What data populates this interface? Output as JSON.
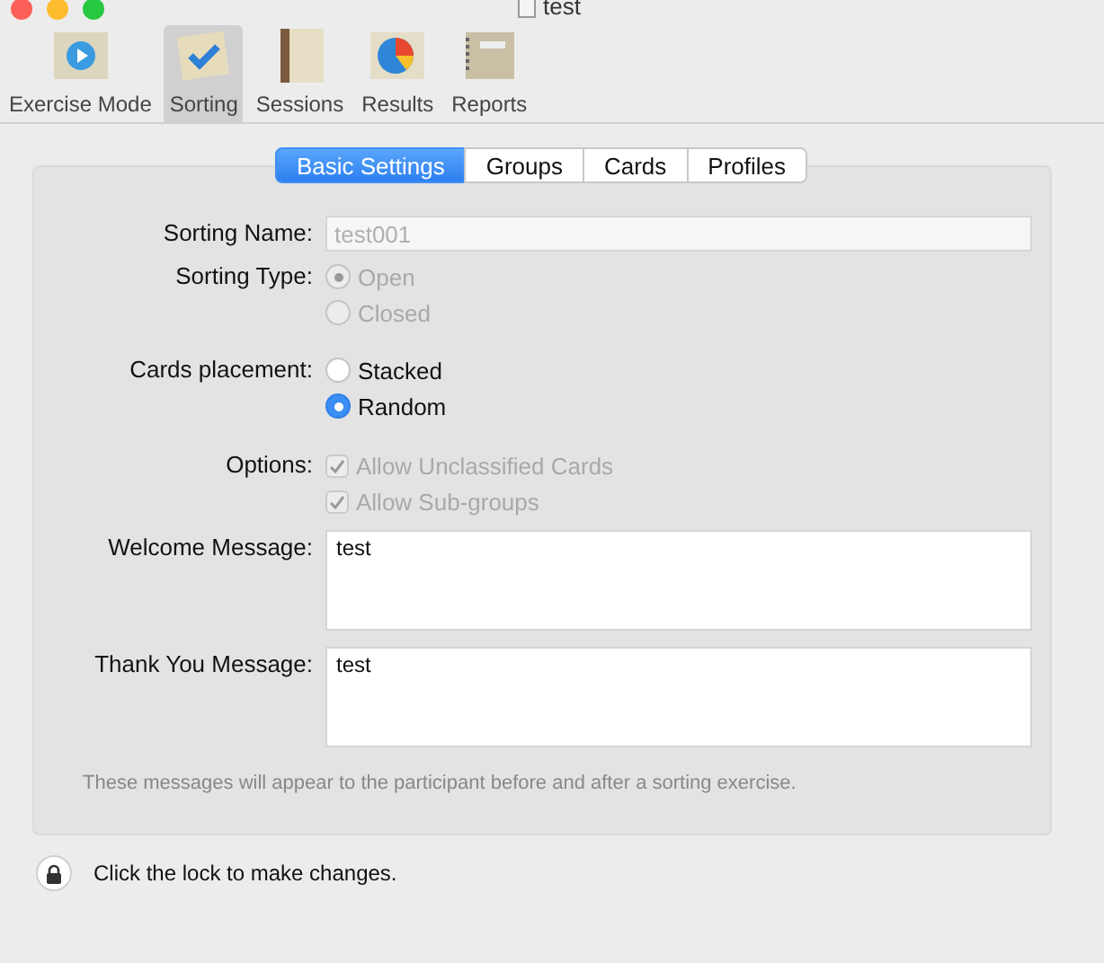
{
  "window": {
    "title": "test"
  },
  "toolbar": [
    {
      "label": "Exercise Mode",
      "selected": false,
      "kind": "play"
    },
    {
      "label": "Sorting",
      "selected": true,
      "kind": "check"
    },
    {
      "label": "Sessions",
      "selected": false,
      "kind": "book"
    },
    {
      "label": "Results",
      "selected": false,
      "kind": "pie"
    },
    {
      "label": "Reports",
      "selected": false,
      "kind": "notebook"
    }
  ],
  "tabs": [
    {
      "label": "Basic Settings",
      "selected": true
    },
    {
      "label": "Groups",
      "selected": false
    },
    {
      "label": "Cards",
      "selected": false
    },
    {
      "label": "Profiles",
      "selected": false
    }
  ],
  "form": {
    "sorting_name": {
      "label": "Sorting Name:",
      "value": "test001",
      "disabled": true
    },
    "sorting_type": {
      "label": "Sorting Type:",
      "disabled": true,
      "options": [
        {
          "label": "Open",
          "selected": true
        },
        {
          "label": "Closed",
          "selected": false
        }
      ]
    },
    "cards_placement": {
      "label": "Cards placement:",
      "disabled": false,
      "options": [
        {
          "label": "Stacked",
          "selected": false
        },
        {
          "label": "Random",
          "selected": true
        }
      ]
    },
    "options": {
      "label": "Options:",
      "disabled": true,
      "items": [
        {
          "label": "Allow Unclassified Cards",
          "checked": true
        },
        {
          "label": "Allow Sub-groups",
          "checked": true
        }
      ]
    },
    "welcome_message": {
      "label": "Welcome Message:",
      "value": "test"
    },
    "thank_you_message": {
      "label": "Thank You Message:",
      "value": "test"
    },
    "note": "These messages will appear to the participant before and after a sorting exercise."
  },
  "lock": {
    "text": "Click the lock to make changes."
  }
}
